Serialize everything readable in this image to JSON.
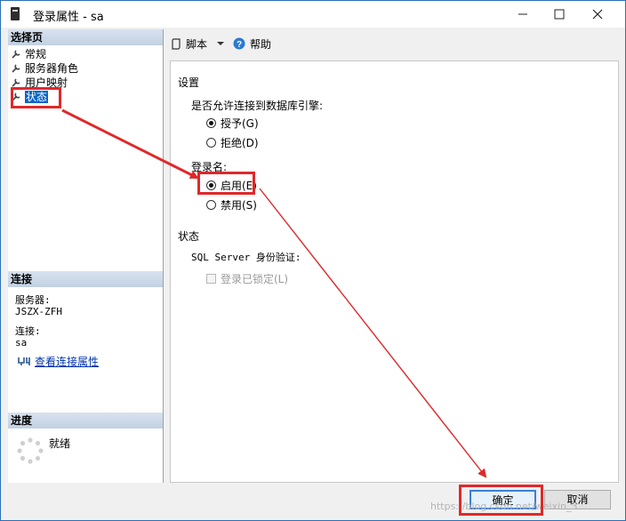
{
  "window": {
    "title": "登录属性 - sa",
    "min_glyph": "—",
    "max_glyph": "☐",
    "close_glyph": "✕"
  },
  "left": {
    "select_page_header": "选择页",
    "nav": [
      {
        "label": "常规",
        "selected": false
      },
      {
        "label": "服务器角色",
        "selected": false
      },
      {
        "label": "用户映射",
        "selected": false
      },
      {
        "label": "状态",
        "selected": true
      }
    ],
    "connection_header": "连接",
    "server_label": "服务器:",
    "server_value": "JSZX-ZFH",
    "connection_label": "连接:",
    "connection_value": "sa",
    "view_connection_link": "查看连接属性",
    "progress_header": "进度",
    "progress_status": "就绪"
  },
  "toolbar": {
    "script_label": "脚本",
    "help_label": "帮助"
  },
  "settings": {
    "section_title": "设置",
    "allow_connect_question": "是否允许连接到数据库引擎:",
    "grant_label": "授予(G)",
    "deny_label": "拒绝(D)",
    "login_label": "登录名:",
    "enable_label": "启用(E)",
    "disable_label": "禁用(S)",
    "status_section_title": "状态",
    "sql_auth_label": "SQL Server 身份验证:",
    "locked_label": "登录已锁定(L)"
  },
  "buttons": {
    "ok_label": "确定",
    "cancel_label": "取消"
  },
  "watermark": "https://blog.csdn.net/weixin_3...",
  "colors": {
    "annotation_red": "#e0282a",
    "selection_blue": "#0a64c8",
    "link_blue": "#0033aa"
  }
}
